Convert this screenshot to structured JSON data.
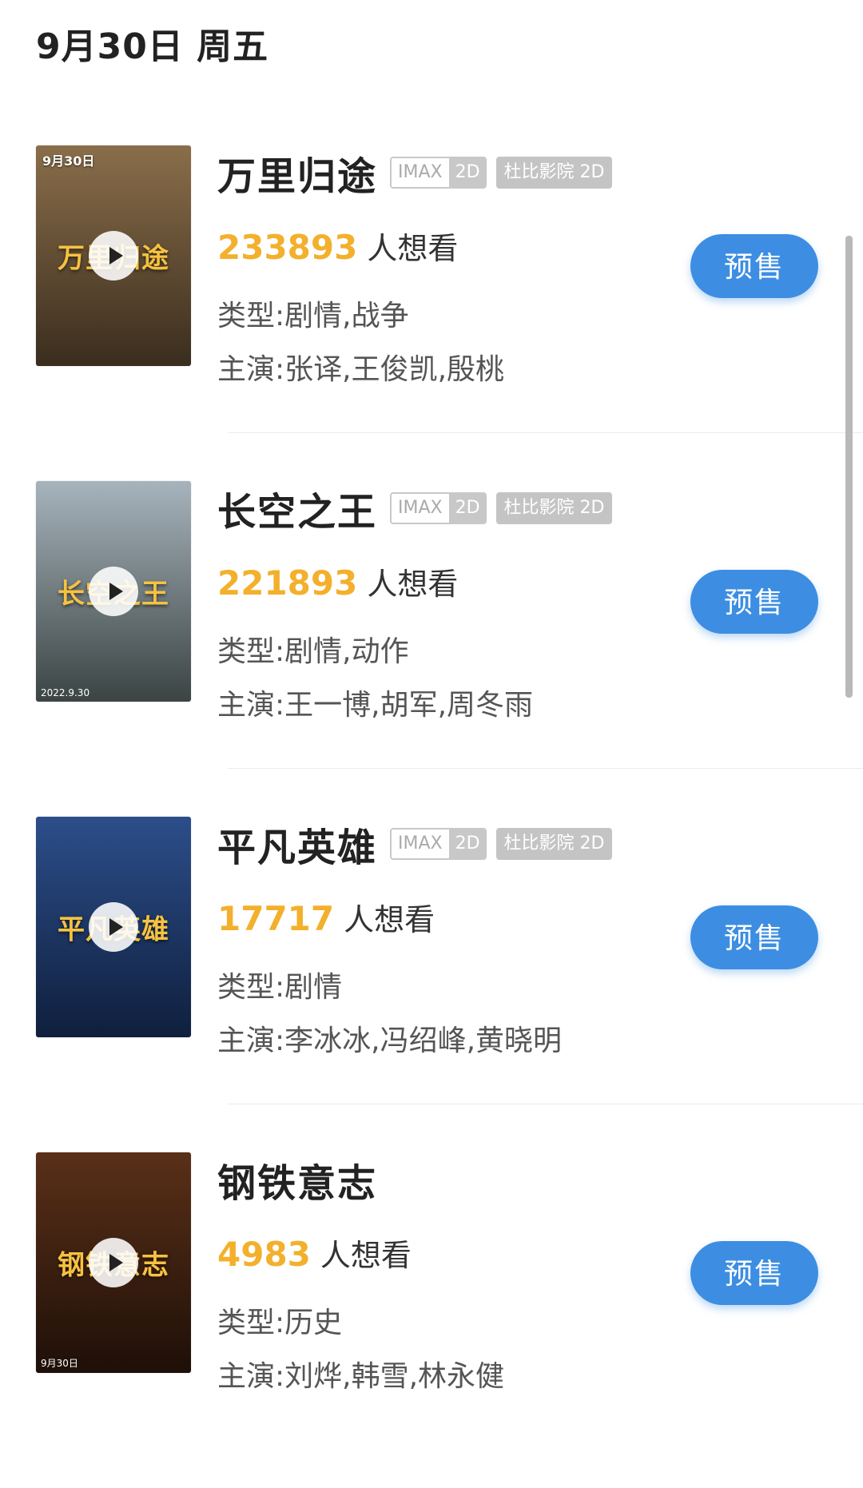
{
  "header": {
    "date_label": "9月30日 周五"
  },
  "common": {
    "imax_label": "IMAX",
    "imax_format": "2D",
    "dolby_label": "杜比影院 2D",
    "want_suffix": "人想看",
    "presale_label": "预售"
  },
  "movies": [
    {
      "title": "万里归途",
      "want_count": "233893",
      "genre": "类型:剧情,战争",
      "cast": "主演:张译,王俊凯,殷桃",
      "poster_title": "万里归途",
      "poster_top": "9月30日",
      "poster_colors": [
        "#8a6e4a",
        "#3a2d1e"
      ]
    },
    {
      "title": "长空之王",
      "want_count": "221893",
      "genre": "类型:剧情,动作",
      "cast": "主演:王一博,胡军,周冬雨",
      "poster_title": "长空之王",
      "poster_bottom": "2022.9.30",
      "poster_colors": [
        "#a7b4bd",
        "#3b4443"
      ]
    },
    {
      "title": "平凡英雄",
      "want_count": "17717",
      "genre": "类型:剧情",
      "cast": "主演:李冰冰,冯绍峰,黄晓明",
      "poster_title": "平凡英雄",
      "poster_colors": [
        "#2c4e8a",
        "#0f1f3d"
      ]
    },
    {
      "title": "钢铁意志",
      "want_count": "4983",
      "genre": "类型:历史",
      "cast": "主演:刘烨,韩雪,林永健",
      "poster_title": "钢铁意志",
      "poster_bottom": "9月30日",
      "poster_colors": [
        "#5a3018",
        "#1e0f08"
      ]
    }
  ]
}
